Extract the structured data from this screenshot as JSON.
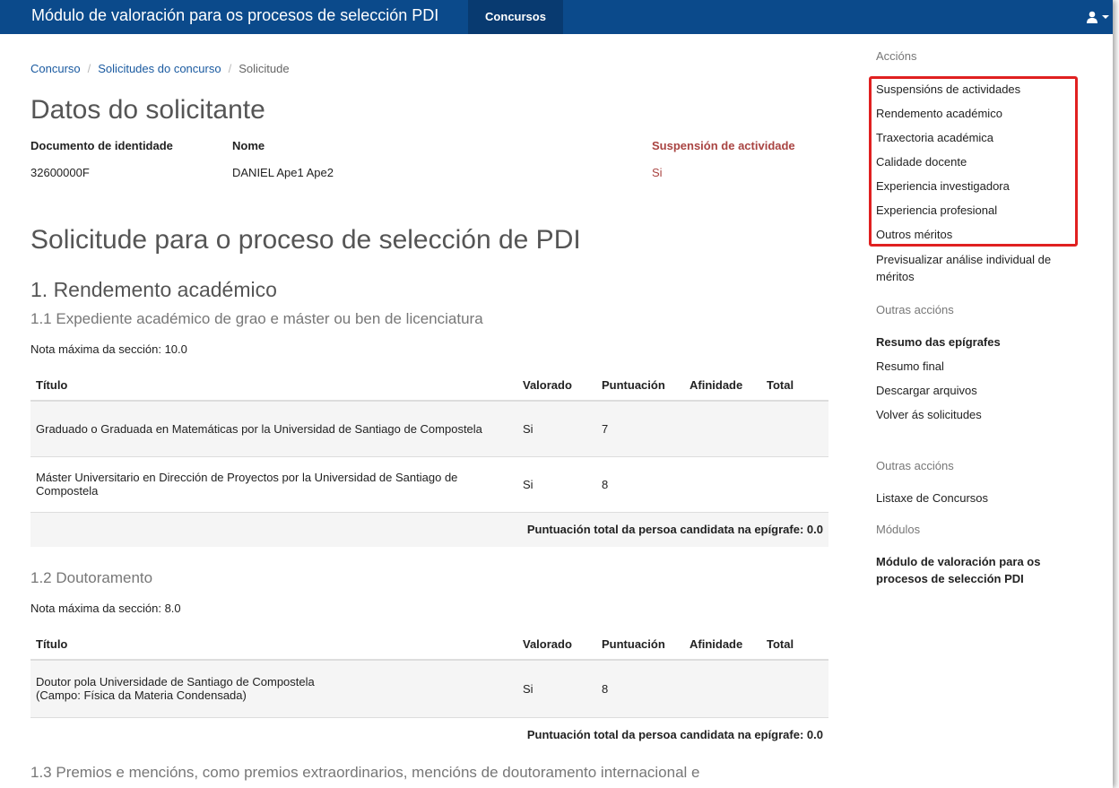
{
  "navbar": {
    "brand": "Módulo de valoración para os procesos de selección PDI",
    "active_tab": "Concursos",
    "user_icon": "user-icon"
  },
  "breadcrumb": {
    "items": [
      "Concurso",
      "Solicitudes do concurso"
    ],
    "current": "Solicitude"
  },
  "applicant": {
    "title": "Datos do solicitante",
    "doc_label": "Documento de identidade",
    "doc_value": "32600000F",
    "name_label": "Nome",
    "name_value": "DANIEL Ape1 Ape2",
    "suspension_label": "Suspensión de actividade",
    "suspension_value": "Si"
  },
  "application": {
    "title": "Solicitude para o proceso de selección de PDI",
    "section1_title": "1. Rendemento académico",
    "sub11": {
      "title": "1.1 Expediente académico de grao e máster ou ben de licenciatura",
      "note": "Nota máxima da sección: 10.0",
      "columns": [
        "Título",
        "Valorado",
        "Puntuación",
        "Afinidade",
        "Total"
      ],
      "rows": [
        {
          "title": "Graduado o Graduada en Matemáticas por la Universidad de Santiago de Compostela",
          "valorado": "Si",
          "puntuacion": "7",
          "afinidade": "",
          "total": ""
        },
        {
          "title": "Máster Universitario en Dirección de Proyectos por la Universidad de Santiago de Compostela",
          "valorado": "Si",
          "puntuacion": "8",
          "afinidade": "",
          "total": ""
        }
      ],
      "footer": "Puntuación total da persoa candidata na epígrafe: 0.0"
    },
    "sub12": {
      "title": "1.2 Doutoramento",
      "note": "Nota máxima da sección: 8.0",
      "columns": [
        "Título",
        "Valorado",
        "Puntuación",
        "Afinidade",
        "Total"
      ],
      "rows": [
        {
          "title_line1": "Doutor pola Universidade de Santiago de Compostela",
          "title_line2": "(Campo: Física da Materia Condensada)",
          "valorado": "Si",
          "puntuacion": "8",
          "afinidade": "",
          "total": ""
        }
      ],
      "footer": "Puntuación total da persoa candidata na epígrafe: 0.0"
    },
    "sub13_title": "1.3 Premios e mencións, como premios extraordinarios, mencións de doutoramento internacional e"
  },
  "sidebar": {
    "actions_heading": "Accións",
    "actions": [
      "Suspensións de actividades",
      "Rendemento académico",
      "Traxectoria académica",
      "Calidade docente",
      "Experiencia investigadora",
      "Experiencia profesional",
      "Outros méritos"
    ],
    "preview_line1": "Previsualizar análise individual de",
    "preview_line2": "méritos",
    "other_heading_1": "Outras accións",
    "other_links": [
      "Resumo das epígrafes",
      "Resumo final",
      "Descargar arquivos",
      "Volver ás solicitudes"
    ],
    "other_heading_2": "Outras accións",
    "list_link": "Listaxe de Concursos",
    "modules_heading": "Módulos",
    "module_line1": "Módulo de valoración para os",
    "module_line2": "procesos de selección PDI",
    "highlight_color": "#e02020"
  }
}
